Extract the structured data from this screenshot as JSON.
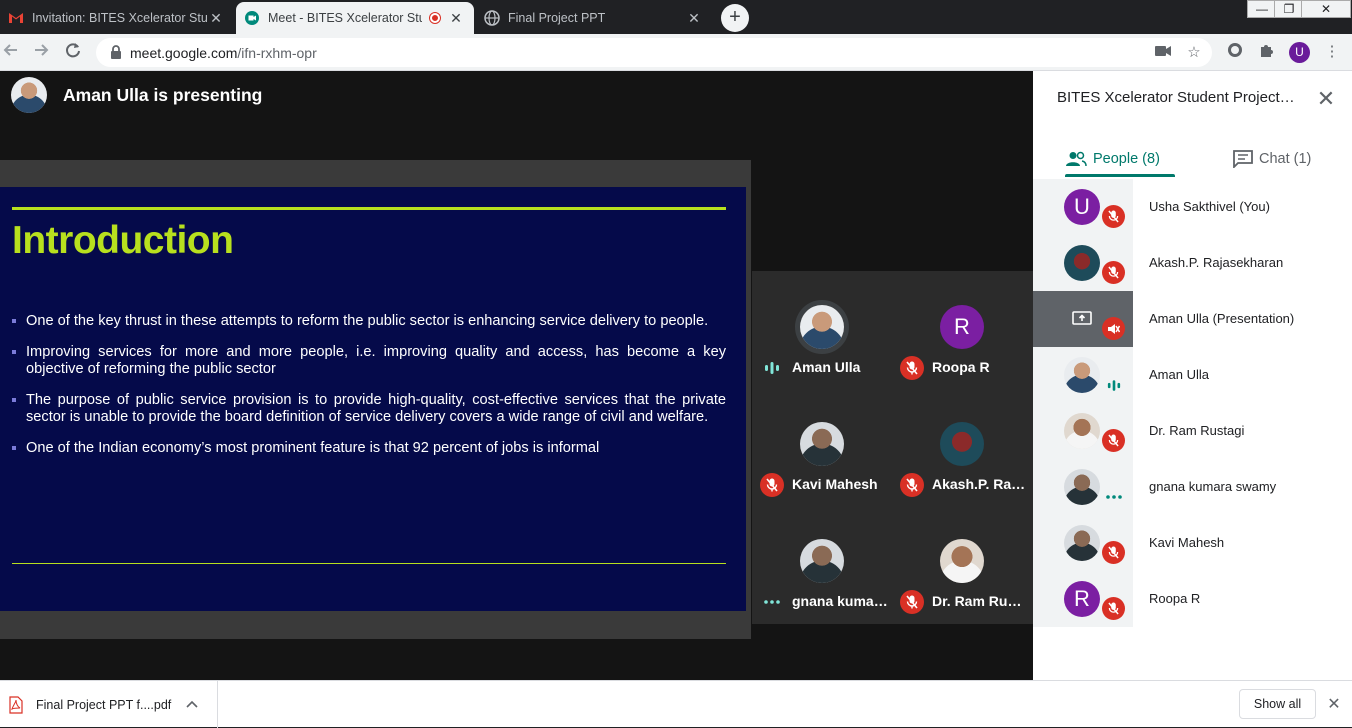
{
  "browser": {
    "tabs": [
      {
        "title": "Invitation: BITES Xcelerator Stude",
        "close": "✕",
        "icon": "gmail-icon"
      },
      {
        "title": "Meet - BITES Xcelerator Stud",
        "close": "✕",
        "icon": "meet-icon",
        "recording": true
      },
      {
        "title": "Final Project PPT",
        "close": "✕",
        "icon": "globe-icon"
      }
    ],
    "new_tab": "+",
    "url_domain": "meet.google.com",
    "url_path": "/ifn-rxhm-opr",
    "profile_initial": "U",
    "window_controls": {
      "minimize": "—",
      "maximize": "❐",
      "close": "✕"
    }
  },
  "stage": {
    "presenting_label": "Aman Ulla is presenting"
  },
  "slide": {
    "title": "Introduction",
    "bullets": [
      "One of the key thrust in these attempts to reform the public sector is enhancing service delivery to people.",
      "Improving services for more and more people, i.e. improving quality and access, has become a key objective of reforming the public sector",
      "The purpose of public service provision is to provide high-quality, cost-effective services that the private sector is unable to provide the board definition of service delivery covers a wide range of civil and welfare.",
      "One of the Indian economy’s most prominent feature is that 92 percent of jobs is informal"
    ],
    "accent_color": "#b8e01e",
    "background_color": "#050a4a"
  },
  "tiles": [
    {
      "name": "Aman Ulla",
      "status": "speaking"
    },
    {
      "name": "Roopa R",
      "status": "muted",
      "initial": "R"
    },
    {
      "name": "Kavi Mahesh",
      "status": "muted"
    },
    {
      "name": "Akash.P. Raja…",
      "status": "muted"
    },
    {
      "name": "gnana kumar…",
      "status": "idle"
    },
    {
      "name": "Dr. Ram Rusta…",
      "status": "muted"
    }
  ],
  "panel": {
    "title": "BITES Xcelerator Student Project…",
    "close": "✕",
    "tab_people": "People (8)",
    "tab_chat": "Chat (1)",
    "people": [
      {
        "name": "Usha Sakthivel (You)",
        "status": "muted",
        "initial": "U"
      },
      {
        "name": "Akash.P. Rajasekharan",
        "status": "muted"
      },
      {
        "name": "Aman Ulla (Presentation)",
        "status": "muted-presentation"
      },
      {
        "name": "Aman Ulla",
        "status": "speaking"
      },
      {
        "name": "Dr. Ram Rustagi",
        "status": "muted"
      },
      {
        "name": "gnana kumara swamy",
        "status": "idle"
      },
      {
        "name": "Kavi Mahesh",
        "status": "muted"
      },
      {
        "name": "Roopa R",
        "status": "muted",
        "initial": "R"
      }
    ]
  },
  "downloads": {
    "file_name": "Final Project PPT f....pdf",
    "show_all": "Show all",
    "close": "✕",
    "chevron": "^"
  },
  "colors": {
    "meet_teal": "#00796b",
    "mute_red": "#d93025",
    "avatar_purple": "#7b1fa2"
  }
}
